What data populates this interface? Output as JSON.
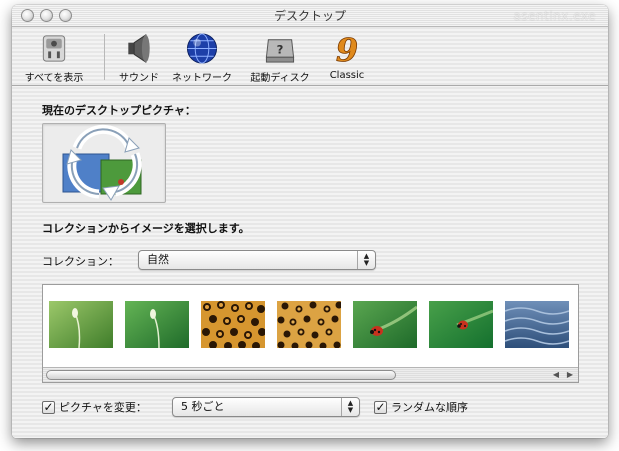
{
  "window": {
    "title": "デスクトップ",
    "ghost_text": "asentinx.exe"
  },
  "toolbar": {
    "items": [
      {
        "label": "すべてを表示",
        "icon": "apple-switch-icon"
      },
      {
        "label": "サウンド",
        "icon": "speaker-icon"
      },
      {
        "label": "ネットワーク",
        "icon": "globe-icon"
      },
      {
        "label": "起動ディスク",
        "icon": "hard-disk-icon"
      },
      {
        "label": "Classic",
        "icon": "classic-nine-icon"
      }
    ]
  },
  "current_picture": {
    "heading": "現在のデスクトップピクチャ："
  },
  "collection": {
    "heading": "コレクションからイメージを選択します。",
    "label": "コレクション：",
    "selected": "自然"
  },
  "thumbnails": [
    {
      "name": "grass-seed",
      "color": "#6da349"
    },
    {
      "name": "grass-seed-2",
      "color": "#3f9a44"
    },
    {
      "name": "leopard",
      "color": "#c88a2f"
    },
    {
      "name": "leopard-2",
      "color": "#d59a3d"
    },
    {
      "name": "ladybug",
      "color": "#3e8c3c"
    },
    {
      "name": "ladybug-2",
      "color": "#2f8e3a"
    },
    {
      "name": "water",
      "color": "#4e6f98"
    }
  ],
  "options": {
    "change_picture_label": "ピクチャを変更：",
    "change_picture_checked": true,
    "interval": "5 秒ごと",
    "random_order_label": "ランダムな順序",
    "random_order_checked": true
  }
}
